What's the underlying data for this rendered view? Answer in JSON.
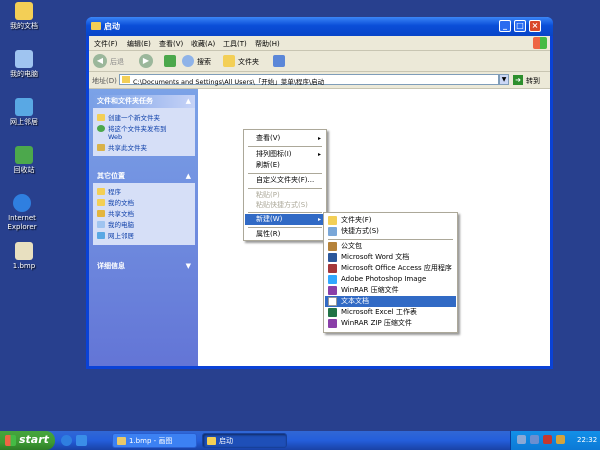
{
  "desktop": {
    "icons": [
      {
        "label": "我的文档",
        "icon": "my-documents-icon",
        "color": "#f3cf56"
      },
      {
        "label": "我的电脑",
        "icon": "my-computer-icon",
        "color": "#9fc4f0"
      },
      {
        "label": "网上邻居",
        "icon": "network-places-icon",
        "color": "#59a8e4"
      },
      {
        "label": "回收站",
        "icon": "recycle-bin-icon",
        "color": "#4ca84c"
      },
      {
        "label": "Internet Explorer",
        "icon": "internet-explorer-icon",
        "color": "#2f7fe0"
      },
      {
        "label": "1.bmp",
        "icon": "bitmap-file-icon",
        "color": "#e8e0c0"
      }
    ]
  },
  "window": {
    "title": "启动",
    "menu": [
      "文件(F)",
      "编辑(E)",
      "查看(V)",
      "收藏(A)",
      "工具(T)",
      "帮助(H)"
    ],
    "toolbar": {
      "back": "后退",
      "search": "搜索",
      "folders": "文件夹"
    },
    "address": {
      "label": "地址(D)",
      "value": "C:\\Documents and Settings\\All Users\\「开始」菜单\\程序\\启动",
      "go": "转到"
    },
    "panels": {
      "tasks": {
        "title": "文件和文件夹任务",
        "items": [
          {
            "line1": "创建一个新文件夹",
            "line2": ""
          },
          {
            "line1": "将这个文件夹发布到",
            "line2": "Web"
          },
          {
            "line1": "共享此文件夹",
            "line2": ""
          }
        ]
      },
      "other": {
        "title": "其它位置",
        "items": [
          "程序",
          "我的文档",
          "共享文档",
          "我的电脑",
          "网上邻居"
        ]
      },
      "details": {
        "title": "详细信息"
      }
    }
  },
  "context_menu": {
    "items": [
      {
        "label": "查看(V)",
        "arrow": "▸",
        "disabled": false
      },
      {
        "label": "排列图标(I)",
        "arrow": "▸",
        "disabled": false
      },
      {
        "label": "刷新(E)",
        "arrow": "",
        "disabled": false
      },
      {
        "label": "自定义文件夹(F)...",
        "arrow": "",
        "disabled": false
      },
      {
        "label": "粘贴(P)",
        "arrow": "",
        "disabled": true
      },
      {
        "label": "粘贴快捷方式(S)",
        "arrow": "",
        "disabled": true
      },
      {
        "label": "新建(W)",
        "arrow": "▸",
        "disabled": false,
        "selected": true
      },
      {
        "label": "属性(R)",
        "arrow": "",
        "disabled": false
      }
    ]
  },
  "new_submenu": {
    "items": [
      {
        "label": "文件夹(F)",
        "icon": "folder-icon",
        "color": "#f3cf56"
      },
      {
        "label": "快捷方式(S)",
        "icon": "shortcut-icon",
        "color": "#7aa7d8"
      },
      {
        "label": "公文包",
        "icon": "briefcase-icon",
        "color": "#b5823a"
      },
      {
        "label": "Microsoft Word 文档",
        "icon": "word-document-icon",
        "color": "#2b579a"
      },
      {
        "label": "Microsoft Office Access 应用程序",
        "icon": "access-icon",
        "color": "#a4373a"
      },
      {
        "label": "Adobe Photoshop Image",
        "icon": "photoshop-icon",
        "color": "#31a8ff"
      },
      {
        "label": "WinRAR 压缩文件",
        "icon": "winrar-icon",
        "color": "#8a3fa8"
      },
      {
        "label": "文本文档",
        "icon": "text-document-icon",
        "color": "#ffffff",
        "selected": true
      },
      {
        "label": "Microsoft Excel 工作表",
        "icon": "excel-icon",
        "color": "#217346"
      },
      {
        "label": "WinRAR ZIP 压缩文件",
        "icon": "winrar-zip-icon",
        "color": "#8a3fa8"
      }
    ]
  },
  "taskbar": {
    "start": "start",
    "tasks": [
      {
        "label": "1.bmp - 画图",
        "icon": "paint-icon"
      },
      {
        "label": "启动",
        "icon": "folder-icon",
        "active": true
      }
    ],
    "clock": "22:32"
  },
  "colors": {
    "selection": "#316ac5",
    "titlebar": "#0a4ed8",
    "taskbar": "#245edb",
    "start": "#3c9a34"
  }
}
